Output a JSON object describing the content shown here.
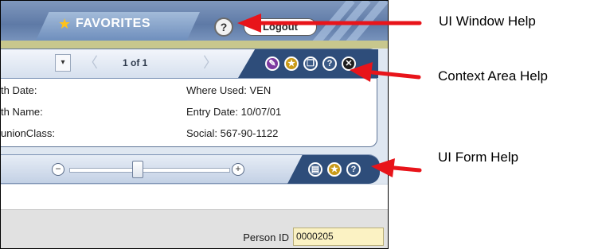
{
  "header": {
    "favorites_label": "FAVORITES",
    "help_label": "?",
    "logout_label": "Logout"
  },
  "context": {
    "dropdown_glyph": "▾",
    "prev_glyph": "〈",
    "next_glyph": "〉",
    "page_counter": "1 of 1",
    "rows": [
      {
        "left": "th Date:",
        "right": "Where Used: VEN"
      },
      {
        "left": "th Name:",
        "right": "Entry Date: 10/07/01"
      },
      {
        "left": "unionClass:",
        "right": "Social: 567-90-1122"
      }
    ],
    "icons": [
      "pin-icon",
      "favorite-star-icon",
      "copy-icon",
      "help-icon",
      "close-icon"
    ]
  },
  "form_toolbar": {
    "zoom_minus": "−",
    "zoom_plus": "+",
    "zoom_level": 0.42,
    "icons": [
      "print-icon",
      "favorite-star-icon",
      "help-icon"
    ]
  },
  "form": {
    "person_id_label": "Person ID",
    "person_id_value": "0000205"
  },
  "annotations": [
    "UI Window Help",
    "Context Area Help",
    "UI Form Help"
  ],
  "colors": {
    "header_blue": "#5e7aa6",
    "tab_dark_blue": "#2e4d7a",
    "field_yellow": "#fbf2c3",
    "arrow_red": "#e8141a"
  }
}
